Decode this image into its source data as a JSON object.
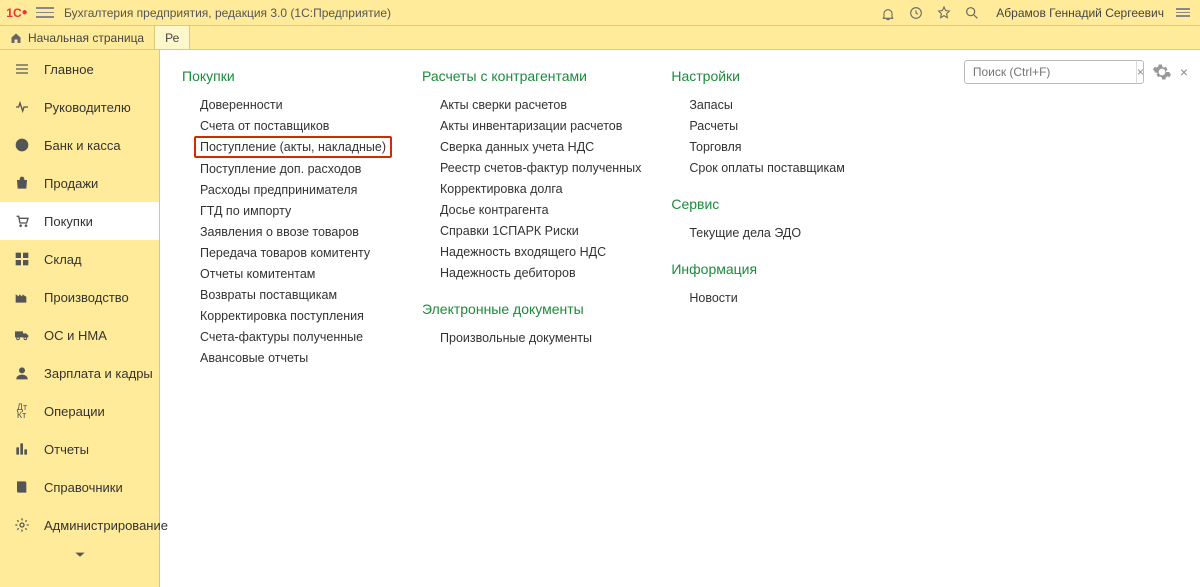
{
  "titlebar": {
    "app_title": "Бухгалтерия предприятия, редакция 3.0   (1С:Предприятие)",
    "user_name": "Абрамов Геннадий Сергеевич"
  },
  "tabs": {
    "home": "Начальная страница",
    "second_truncated": "Ре"
  },
  "sidebar": {
    "items": [
      "Главное",
      "Руководителю",
      "Банк и касса",
      "Продажи",
      "Покупки",
      "Склад",
      "Производство",
      "ОС и НМА",
      "Зарплата и кадры",
      "Операции",
      "Отчеты",
      "Справочники",
      "Администрирование"
    ]
  },
  "main": {
    "search_placeholder": "Поиск (Ctrl+F)",
    "col1": {
      "header": "Покупки",
      "items": [
        "Доверенности",
        "Счета от поставщиков",
        "Поступление (акты, накладные)",
        "Поступление доп. расходов",
        "Расходы предпринимателя",
        "ГТД по импорту",
        "Заявления о ввозе товаров",
        "Передача товаров комитенту",
        "Отчеты комитентам",
        "Возвраты поставщикам",
        "Корректировка поступления",
        "Счета-фактуры полученные",
        "Авансовые отчеты"
      ]
    },
    "col2": {
      "header1": "Расчеты с контрагентами",
      "group1": [
        "Акты сверки расчетов",
        "Акты инвентаризации расчетов",
        "Сверка данных учета НДС",
        "Реестр счетов-фактур полученных",
        "Корректировка долга",
        "Досье контрагента",
        "Справки 1СПАРК Риски",
        "Надежность входящего НДС",
        "Надежность дебиторов"
      ],
      "header2": "Электронные документы",
      "group2": [
        "Произвольные документы"
      ]
    },
    "col3": {
      "header1": "Настройки",
      "group1": [
        "Запасы",
        "Расчеты",
        "Торговля",
        "Срок оплаты поставщикам"
      ],
      "header2": "Сервис",
      "group2": [
        "Текущие дела ЭДО"
      ],
      "header3": "Информация",
      "group3": [
        "Новости"
      ]
    }
  }
}
